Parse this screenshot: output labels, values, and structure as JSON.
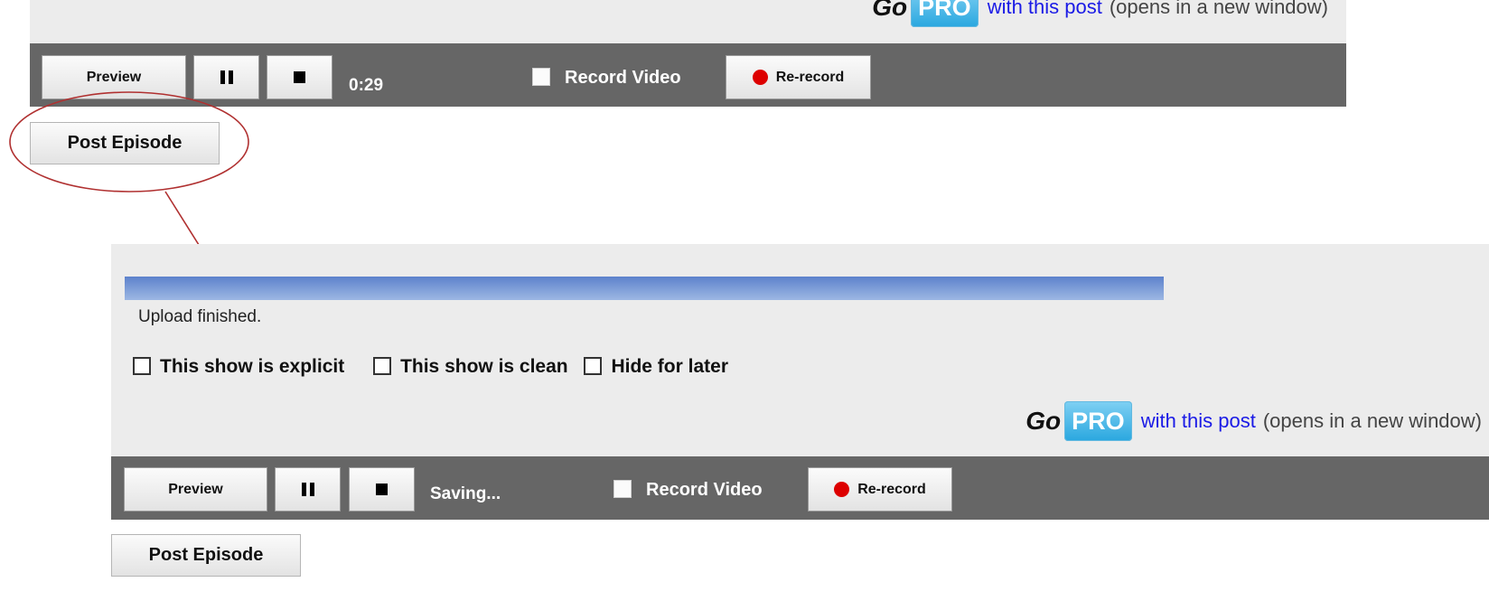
{
  "top": {
    "gopro": {
      "go": "Go",
      "pro": "PRO",
      "link": "with this post",
      "note": "(opens in a new window)"
    },
    "toolbar": {
      "preview": "Preview",
      "time": "0:29",
      "record_video": "Record Video",
      "rerecord": "Re-record"
    },
    "post_episode": "Post Episode"
  },
  "bottom": {
    "upload_progress": 1.0,
    "upload_status": "Upload finished.",
    "options": [
      "This show is explicit",
      "This show is clean",
      "Hide for later"
    ],
    "gopro": {
      "go": "Go",
      "pro": "PRO",
      "link": "with this post",
      "note": "(opens in a new window)"
    },
    "toolbar": {
      "preview": "Preview",
      "status": "Saving...",
      "record_video": "Record Video",
      "rerecord": "Re-record"
    },
    "post_episode": "Post Episode"
  },
  "colors": {
    "toolbar_bg": "#666666",
    "panel_bg": "#ececec",
    "progress": "#7e9bd6",
    "link": "#1a1ae6",
    "annotation": "#b03030",
    "record_dot": "#dd0000"
  },
  "icons": [
    "pause-icon",
    "stop-icon",
    "record-dot-icon",
    "checkbox-icon"
  ]
}
